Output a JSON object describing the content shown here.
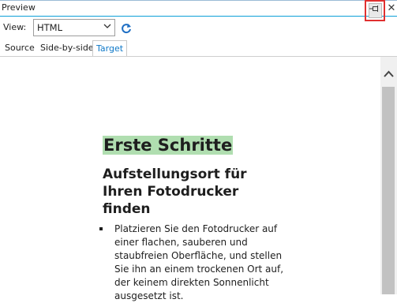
{
  "panel": {
    "title": "Preview"
  },
  "view": {
    "label": "View:",
    "selected": "HTML"
  },
  "tabs": [
    {
      "label": "Source"
    },
    {
      "label": "Side-by-side"
    },
    {
      "label": "Target"
    }
  ],
  "document": {
    "heading1": "Erste Schritte",
    "heading2": "Aufstellungsort für Ihren Fotodrucker finden",
    "paragraph": "Platzieren Sie den Fotodrucker auf einer flachen, sauberen und staubfreien Oberfläche, und stellen Sie ihn an einem trockenen Ort auf, der keinem direkten Sonnenlicht ausgesetzt ist."
  },
  "colors": {
    "accent": "#0e9fd8",
    "highlight": "#b0deb0",
    "annotation": "#e03030"
  },
  "icons": {
    "pin": "pin-icon",
    "close": "close-icon",
    "refresh": "refresh-icon",
    "dropdown": "chevron-down-icon",
    "scroll_up": "chevron-up-icon"
  }
}
